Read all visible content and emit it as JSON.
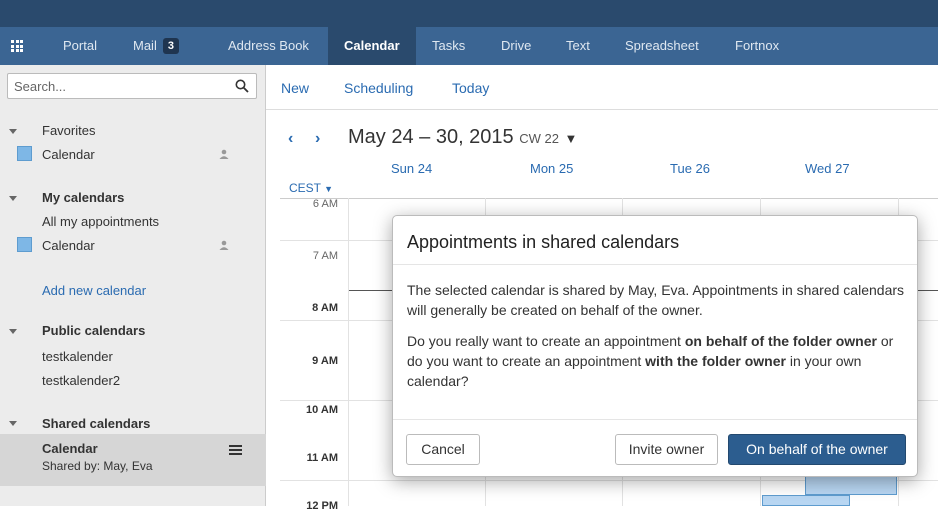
{
  "topnav": {
    "items": [
      "Portal",
      "Mail",
      "Address Book",
      "Calendar",
      "Tasks",
      "Drive",
      "Text",
      "Spreadsheet",
      "Fortnox"
    ],
    "mail_badge": "3",
    "active": "Calendar"
  },
  "search": {
    "placeholder": "Search..."
  },
  "sidebar": {
    "favorites": {
      "title": "Favorites",
      "items": [
        "Calendar"
      ]
    },
    "my_calendars": {
      "title": "My calendars",
      "items": [
        "All my appointments",
        "Calendar"
      ],
      "add_link": "Add new calendar"
    },
    "public_calendars": {
      "title": "Public calendars",
      "items": [
        "testkalender",
        "testkalender2"
      ]
    },
    "shared_calendars": {
      "title": "Shared calendars",
      "selected_name": "Calendar",
      "selected_sub": "Shared by: May, Eva"
    }
  },
  "toolbar": {
    "new": "New",
    "scheduling": "Scheduling",
    "today": "Today"
  },
  "calendar": {
    "range": "May 24 – 30, 2015",
    "week": "CW 22",
    "timezone": "CEST",
    "days": [
      "Sun 24",
      "Mon 25",
      "Tue 26",
      "Wed 27"
    ],
    "hours": [
      "6 AM",
      "7 AM",
      "8 AM",
      "9 AM",
      "10 AM",
      "11 AM",
      "12 PM"
    ]
  },
  "dialog": {
    "title": "Appointments in shared calendars",
    "para1": "The selected calendar is shared by May, Eva. Appointments in shared calendars will generally be created on behalf of the owner.",
    "para2_a": "Do you really want to create an appointment ",
    "para2_b": "on behalf of the folder owner",
    "para2_c": " or do you want to create an appointment ",
    "para2_d": "with the folder owner",
    "para2_e": " in your own calendar?",
    "cancel": "Cancel",
    "invite": "Invite owner",
    "behalf": "On behalf of the owner"
  },
  "colors": {
    "topbar": "#3b6593",
    "accent": "#2a6bb1",
    "primary_button": "#2c5d8f"
  }
}
